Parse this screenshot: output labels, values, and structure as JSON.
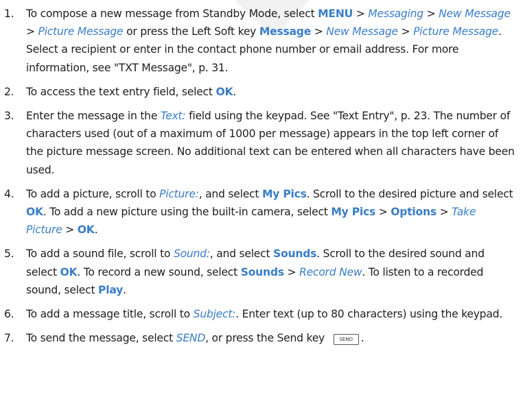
{
  "watermark": "Draft",
  "steps": [
    {
      "num": "1.",
      "segments": [
        {
          "t": "To compose a new message from Standby Mode, select "
        },
        {
          "t": "MENU",
          "s": "kw"
        },
        {
          "t": " > "
        },
        {
          "t": "Messaging",
          "s": "it"
        },
        {
          "t": " > "
        },
        {
          "t": "New Message",
          "s": "it"
        },
        {
          "t": " > "
        },
        {
          "t": "Picture Message",
          "s": "it"
        },
        {
          "t": " or press the Left Soft key "
        },
        {
          "t": "Message",
          "s": "kw"
        },
        {
          "t": " > "
        },
        {
          "t": "New Message",
          "s": "it"
        },
        {
          "t": " > "
        },
        {
          "t": "Picture Message",
          "s": "it"
        },
        {
          "t": ". Select a recipient or enter in the contact phone number or email address. For more information, see \"TXT Message\", p. 31."
        }
      ]
    },
    {
      "num": "2.",
      "segments": [
        {
          "t": "To access the text entry field, select "
        },
        {
          "t": "OK",
          "s": "kw"
        },
        {
          "t": "."
        }
      ]
    },
    {
      "num": "3.",
      "segments": [
        {
          "t": "Enter the message in the "
        },
        {
          "t": "Text:",
          "s": "it"
        },
        {
          "t": " field using the keypad. See \"Text Entry\", p. 23. The number of characters used (out of a maximum of 1000 per message) appears in the top left corner of the picture message screen. No additional text can be entered when all characters have been used."
        }
      ]
    },
    {
      "num": "4.",
      "segments": [
        {
          "t": "To add a picture, scroll to "
        },
        {
          "t": "Picture:",
          "s": "it"
        },
        {
          "t": ", and select "
        },
        {
          "t": "My Pics",
          "s": "kw"
        },
        {
          "t": ". Scroll to the desired picture and select "
        },
        {
          "t": "OK",
          "s": "kw"
        },
        {
          "t": ". To add a new picture using the built-in camera, select "
        },
        {
          "t": "My Pics",
          "s": "kw"
        },
        {
          "t": " > "
        },
        {
          "t": "Options",
          "s": "kw"
        },
        {
          "t": " > "
        },
        {
          "t": "Take Picture",
          "s": "it"
        },
        {
          "t": " > "
        },
        {
          "t": "OK",
          "s": "kw"
        },
        {
          "t": "."
        }
      ]
    },
    {
      "num": "5.",
      "segments": [
        {
          "t": "To add a sound file, scroll to "
        },
        {
          "t": "Sound:",
          "s": "it"
        },
        {
          "t": ", and select "
        },
        {
          "t": "Sounds",
          "s": "kw"
        },
        {
          "t": ". Scroll to the desired sound and select "
        },
        {
          "t": "OK",
          "s": "kw"
        },
        {
          "t": ". To record a new sound, select "
        },
        {
          "t": "Sounds",
          "s": "kw"
        },
        {
          "t": " > "
        },
        {
          "t": "Record New",
          "s": "it"
        },
        {
          "t": ". To listen to a recorded sound, select "
        },
        {
          "t": "Play",
          "s": "kw"
        },
        {
          "t": "."
        }
      ]
    },
    {
      "num": "6.",
      "segments": [
        {
          "t": "To add a message title, scroll to "
        },
        {
          "t": "Subject:",
          "s": "it"
        },
        {
          "t": ". Enter text (up to 80 characters) using the keypad."
        }
      ]
    },
    {
      "num": "7.",
      "segments": [
        {
          "t": "To send the message, select "
        },
        {
          "t": "SEND",
          "s": "it"
        },
        {
          "t": ", or press the Send key "
        },
        {
          "t": "SEND",
          "s": "keycap"
        },
        {
          "t": "."
        }
      ]
    }
  ]
}
